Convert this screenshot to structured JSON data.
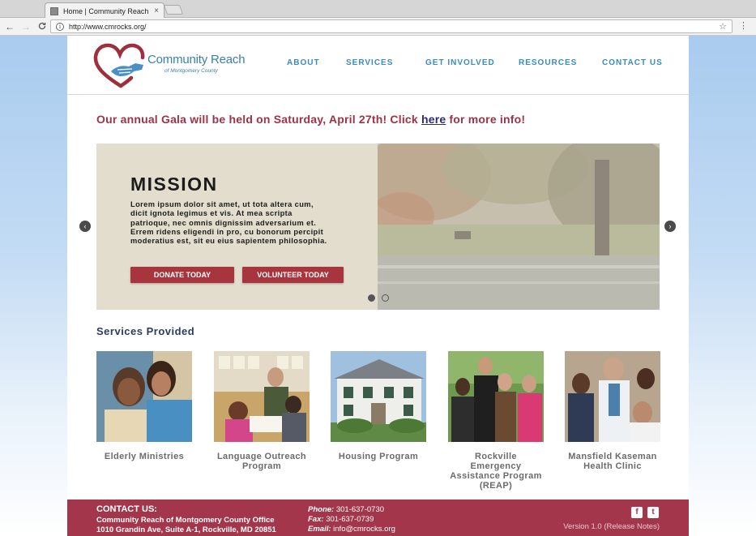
{
  "browser": {
    "tab_title": "Home | Community Reach of",
    "tab_close": "×",
    "url": "http://www.cmrocks.org/",
    "back": "←",
    "forward": "→",
    "reload": "C",
    "info": "i",
    "star": "☆",
    "menu": "⋮"
  },
  "site": {
    "logo": {
      "name": "Community Reach",
      "sub": "of Montgomery County"
    },
    "nav": [
      "ABOUT",
      "SERVICES",
      "GET INVOLVED",
      "RESOURCES",
      "CONTACT US"
    ],
    "alert": {
      "before": "Our annual Gala will be held on Saturday, April 27th! Click ",
      "link": "here",
      "after": " for more info!"
    },
    "carousel": {
      "title": "MISSION",
      "body": "Lorem ipsum dolor sit amet, ut tota altera cum, dicit ignota legimus et vis. At mea scripta patrioque, nec omnis dignissim adversarium et. Errem ridens eligendi in pro, cu bonorum percipit moderatius est, sit eu eius sapientem philosophia.",
      "donate": "DONATE TODAY",
      "volunteer": "VOLUNTEER TODAY",
      "prev": "‹",
      "next": "›",
      "slide_count": 2,
      "active_slide": 1
    },
    "services_heading": "Services Provided",
    "services": [
      "Elderly Ministries",
      "Language Outreach Program",
      "Housing Program",
      "Rockville Emergency Assistance Program (REAP)",
      "Mansfield Kaseman Health Clinic"
    ],
    "footer": {
      "title": "CONTACT US:",
      "org": "Community Reach of Montgomery County Office",
      "address": "1010 Grandin Ave, Suite A-1, Rockville, MD 20851",
      "phone_label": "Phone:",
      "phone": "301-637-0730",
      "fax_label": "Fax:",
      "fax": "301-637-0739",
      "email_label": "Email:",
      "email": "info@cmrocks.org",
      "facebook": "f",
      "twitter": "t",
      "version": "Version 1.0  (Release Notes)"
    }
  },
  "colors": {
    "brand_red": "#a3364a",
    "brand_blue": "#3a8bc2",
    "mission_bg": "#e2ddcc"
  }
}
